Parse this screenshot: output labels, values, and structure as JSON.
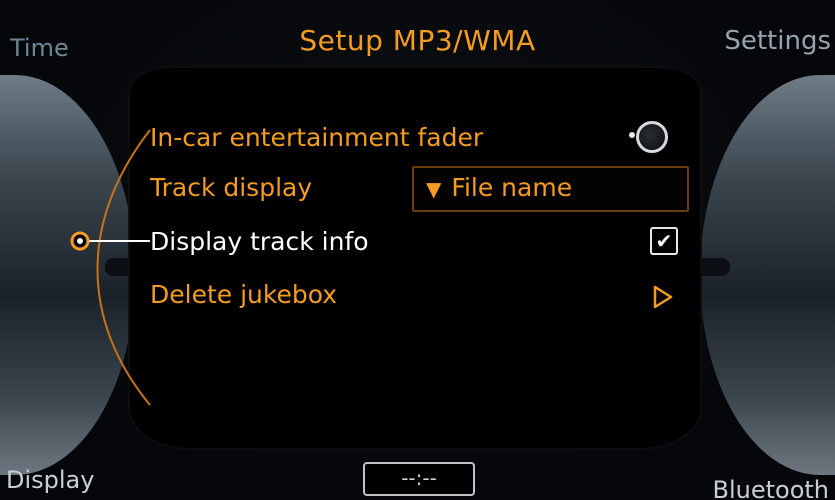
{
  "header": {
    "title": "Setup MP3/WMA",
    "left_label": "Time",
    "right_label": "Settings"
  },
  "footer": {
    "left_label": "Display",
    "center_clock": "--:--",
    "right_label": "Bluetooth"
  },
  "menu": {
    "items": [
      {
        "label": "In-car entertainment fader",
        "control": "fader-knob"
      },
      {
        "label": "Track display",
        "control": "dropdown",
        "value": "File name",
        "icon": "triangle-down-icon"
      },
      {
        "label": "Display track info",
        "control": "checkbox",
        "checked": true,
        "selected": true
      },
      {
        "label": "Delete jukebox",
        "control": "arrow",
        "icon": "play-arrow-icon"
      }
    ]
  },
  "colors": {
    "accent": "#f39c21",
    "selected_text": "#ffffff",
    "corner_text": "#6e8797",
    "panel_bg": "#000000"
  }
}
